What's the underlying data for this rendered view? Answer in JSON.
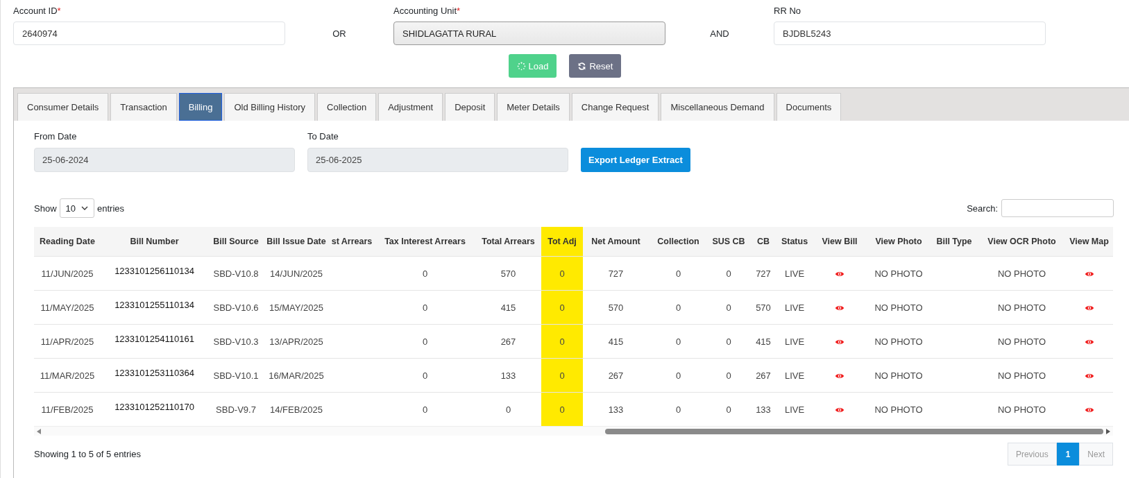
{
  "search_fields": [
    {
      "label": "Account ID",
      "required_mark": "*",
      "value": "2640974"
    },
    {
      "label": "Accounting Unit",
      "required_mark": "*",
      "value": "SHIDLAGATTA RURAL"
    },
    {
      "label": "RR No",
      "value": "BJDBL5243"
    }
  ],
  "connectors": [
    "OR",
    "AND"
  ],
  "actions": [
    {
      "label": "Load",
      "kind": "load"
    },
    {
      "label": "Reset",
      "kind": "reset"
    }
  ],
  "tabs": [
    {
      "label": "Consumer Details",
      "selected": false
    },
    {
      "label": "Transaction",
      "selected": false
    },
    {
      "label": "Billing",
      "selected": true
    },
    {
      "label": "Old Billing History",
      "selected": false
    },
    {
      "label": "Collection",
      "selected": false
    },
    {
      "label": "Adjustment",
      "selected": false
    },
    {
      "label": "Deposit",
      "selected": false
    },
    {
      "label": "Meter Details",
      "selected": false
    },
    {
      "label": "Change Request",
      "selected": false
    },
    {
      "label": "Miscellaneous Demand",
      "selected": false
    },
    {
      "label": "Documents",
      "selected": false
    }
  ],
  "date_filters": [
    {
      "label": "From Date",
      "value": "25-06-2024"
    },
    {
      "label": "To Date",
      "value": "25-06-2025"
    }
  ],
  "export_button": "Export Ledger Extract",
  "length_menu": {
    "before": "Show",
    "value": "10",
    "after": "entries"
  },
  "search": {
    "label": "Search:"
  },
  "table": {
    "columns": [
      {
        "label": "Reading Date",
        "highlighted": false
      },
      {
        "label": "Bill Number",
        "highlighted": false
      },
      {
        "label": "Bill Source",
        "highlighted": false
      },
      {
        "label": "Bill Issue Date",
        "highlighted": false
      },
      {
        "label": "st Arrears",
        "highlighted": false
      },
      {
        "label": "Tax Interest Arrears",
        "highlighted": false
      },
      {
        "label": "Total Arrears",
        "highlighted": false
      },
      {
        "label": "Tot Adj",
        "highlighted": true
      },
      {
        "label": "Net Amount",
        "highlighted": false
      },
      {
        "label": "Collection",
        "highlighted": false
      },
      {
        "label": "SUS CB",
        "highlighted": false
      },
      {
        "label": "CB",
        "highlighted": false
      },
      {
        "label": "Status",
        "highlighted": false
      },
      {
        "label": "View Bill",
        "highlighted": false
      },
      {
        "label": "View Photo",
        "highlighted": false
      },
      {
        "label": "Bill Type",
        "highlighted": false
      },
      {
        "label": "View OCR Photo",
        "highlighted": false
      },
      {
        "label": "View Map",
        "highlighted": false
      }
    ],
    "rows": [
      {
        "cells": [
          {
            "kind": "text",
            "text": "11/JUN/2025"
          },
          {
            "kind": "text",
            "text": "1233101256110134"
          },
          {
            "kind": "text",
            "text": "SBD-V10.8"
          },
          {
            "kind": "text",
            "text": "14/JUN/2025"
          },
          {
            "kind": "blank"
          },
          {
            "kind": "text",
            "text": "0"
          },
          {
            "kind": "text",
            "text": "570"
          },
          {
            "kind": "text",
            "text": "0"
          },
          {
            "kind": "text",
            "text": "727"
          },
          {
            "kind": "text",
            "text": "0"
          },
          {
            "kind": "text",
            "text": "0"
          },
          {
            "kind": "text",
            "text": "727"
          },
          {
            "kind": "text",
            "text": "LIVE"
          },
          {
            "kind": "eye"
          },
          {
            "kind": "text",
            "text": "NO PHOTO"
          },
          {
            "kind": "blank"
          },
          {
            "kind": "text",
            "text": "NO PHOTO"
          },
          {
            "kind": "eye"
          }
        ]
      },
      {
        "cells": [
          {
            "kind": "text",
            "text": "11/MAY/2025"
          },
          {
            "kind": "text",
            "text": "1233101255110134"
          },
          {
            "kind": "text",
            "text": "SBD-V10.6"
          },
          {
            "kind": "text",
            "text": "15/MAY/2025"
          },
          {
            "kind": "blank"
          },
          {
            "kind": "text",
            "text": "0"
          },
          {
            "kind": "text",
            "text": "415"
          },
          {
            "kind": "text",
            "text": "0"
          },
          {
            "kind": "text",
            "text": "570"
          },
          {
            "kind": "text",
            "text": "0"
          },
          {
            "kind": "text",
            "text": "0"
          },
          {
            "kind": "text",
            "text": "570"
          },
          {
            "kind": "text",
            "text": "LIVE"
          },
          {
            "kind": "eye"
          },
          {
            "kind": "text",
            "text": "NO PHOTO"
          },
          {
            "kind": "blank"
          },
          {
            "kind": "text",
            "text": "NO PHOTO"
          },
          {
            "kind": "eye"
          }
        ]
      },
      {
        "cells": [
          {
            "kind": "text",
            "text": "11/APR/2025"
          },
          {
            "kind": "text",
            "text": "1233101254110161"
          },
          {
            "kind": "text",
            "text": "SBD-V10.3"
          },
          {
            "kind": "text",
            "text": "13/APR/2025"
          },
          {
            "kind": "blank"
          },
          {
            "kind": "text",
            "text": "0"
          },
          {
            "kind": "text",
            "text": "267"
          },
          {
            "kind": "text",
            "text": "0"
          },
          {
            "kind": "text",
            "text": "415"
          },
          {
            "kind": "text",
            "text": "0"
          },
          {
            "kind": "text",
            "text": "0"
          },
          {
            "kind": "text",
            "text": "415"
          },
          {
            "kind": "text",
            "text": "LIVE"
          },
          {
            "kind": "eye"
          },
          {
            "kind": "text",
            "text": "NO PHOTO"
          },
          {
            "kind": "blank"
          },
          {
            "kind": "text",
            "text": "NO PHOTO"
          },
          {
            "kind": "eye"
          }
        ]
      },
      {
        "cells": [
          {
            "kind": "text",
            "text": "11/MAR/2025"
          },
          {
            "kind": "text",
            "text": "1233101253110364"
          },
          {
            "kind": "text",
            "text": "SBD-V10.1"
          },
          {
            "kind": "text",
            "text": "16/MAR/2025"
          },
          {
            "kind": "blank"
          },
          {
            "kind": "text",
            "text": "0"
          },
          {
            "kind": "text",
            "text": "133"
          },
          {
            "kind": "text",
            "text": "0"
          },
          {
            "kind": "text",
            "text": "267"
          },
          {
            "kind": "text",
            "text": "0"
          },
          {
            "kind": "text",
            "text": "0"
          },
          {
            "kind": "text",
            "text": "267"
          },
          {
            "kind": "text",
            "text": "LIVE"
          },
          {
            "kind": "eye"
          },
          {
            "kind": "text",
            "text": "NO PHOTO"
          },
          {
            "kind": "blank"
          },
          {
            "kind": "text",
            "text": "NO PHOTO"
          },
          {
            "kind": "eye"
          }
        ]
      },
      {
        "cells": [
          {
            "kind": "text",
            "text": "11/FEB/2025"
          },
          {
            "kind": "text",
            "text": "1233101252110170"
          },
          {
            "kind": "text",
            "text": "SBD-V9.7"
          },
          {
            "kind": "text",
            "text": "14/FEB/2025"
          },
          {
            "kind": "blank"
          },
          {
            "kind": "text",
            "text": "0"
          },
          {
            "kind": "text",
            "text": "0"
          },
          {
            "kind": "text",
            "text": "0"
          },
          {
            "kind": "text",
            "text": "133"
          },
          {
            "kind": "text",
            "text": "0"
          },
          {
            "kind": "text",
            "text": "0"
          },
          {
            "kind": "text",
            "text": "133"
          },
          {
            "kind": "text",
            "text": "LIVE"
          },
          {
            "kind": "eye"
          },
          {
            "kind": "text",
            "text": "NO PHOTO"
          },
          {
            "kind": "blank"
          },
          {
            "kind": "text",
            "text": "NO PHOTO"
          },
          {
            "kind": "eye"
          }
        ]
      }
    ]
  },
  "info": "Showing 1 to 5 of 5 entries",
  "pagination": [
    {
      "label": "Previous",
      "kind": "nav",
      "disabled": true,
      "selected": false
    },
    {
      "label": "1",
      "kind": "page",
      "disabled": false,
      "selected": true
    },
    {
      "label": "Next",
      "kind": "nav",
      "disabled": true,
      "selected": false
    }
  ]
}
